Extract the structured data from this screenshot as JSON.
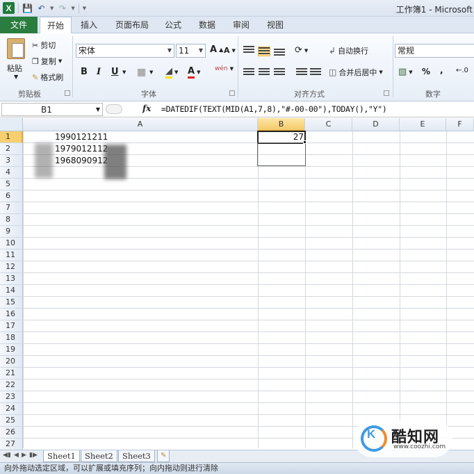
{
  "titlebar": {
    "title": "工作簿1 - Microsoft"
  },
  "tabs": [
    {
      "label": "文件"
    },
    {
      "label": "开始"
    },
    {
      "label": "插入"
    },
    {
      "label": "页面布局"
    },
    {
      "label": "公式"
    },
    {
      "label": "数据"
    },
    {
      "label": "审阅"
    },
    {
      "label": "视图"
    }
  ],
  "ribbon": {
    "clipboard": {
      "paste": "粘贴",
      "cut": "剪切",
      "copy": "复制",
      "format_painter": "格式刷",
      "label": "剪贴板"
    },
    "font": {
      "name": "宋体",
      "size": "11",
      "bold": "B",
      "italic": "I",
      "underline": "U",
      "grow": "A",
      "shrink": "A",
      "label": "字体",
      "font_color_letter": "A",
      "wen": "wén"
    },
    "alignment": {
      "wrap": "自动换行",
      "merge": "合并后居中",
      "label": "对齐方式"
    },
    "number": {
      "format": "常规",
      "percent": "%",
      "comma": ",",
      "label": "数字"
    }
  },
  "formula_bar": {
    "name_box": "B1",
    "fx": "fx",
    "formula": "=DATEDIF(TEXT(MID(A1,7,8),\"#-00-00\"),TODAY(),\"Y\")"
  },
  "columns": [
    "A",
    "B",
    "C",
    "D",
    "E",
    "F"
  ],
  "rows": [
    "1",
    "2",
    "3",
    "4",
    "5",
    "6",
    "7",
    "8",
    "9",
    "10",
    "11",
    "12",
    "13",
    "14",
    "15",
    "16",
    "17",
    "18",
    "19",
    "20",
    "21",
    "22",
    "23",
    "24",
    "25",
    "26",
    "27"
  ],
  "cells": {
    "A1": "1990121211",
    "A2": "1979012112",
    "A3": "1968090912",
    "B1": "27"
  },
  "sheets": [
    "Sheet1",
    "Sheet2",
    "Sheet3"
  ],
  "status": "向外拖动选定区域，可以扩展或填充序列；向内拖动则进行清除",
  "watermark": {
    "name": "酷知网",
    "url": "www.coozhi.com"
  }
}
